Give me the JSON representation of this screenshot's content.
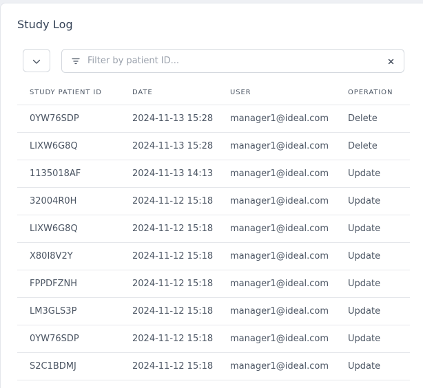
{
  "panel": {
    "title": "Study Log"
  },
  "toolbar": {
    "toggle_icon": "chevron-down-icon",
    "filter_icon": "filter-icon",
    "filter_placeholder": "Filter by patient ID...",
    "filter_value": "",
    "clear_icon": "close-icon"
  },
  "table": {
    "headers": {
      "patient_id": "STUDY PATIENT ID",
      "date": "DATE",
      "user": "USER",
      "operation": "OPERATION"
    },
    "rows": [
      {
        "patient_id": "0YW76SDP",
        "date": "2024-11-13 15:28",
        "user": "manager1@ideal.com",
        "operation": "Delete"
      },
      {
        "patient_id": "LIXW6G8Q",
        "date": "2024-11-13 15:28",
        "user": "manager1@ideal.com",
        "operation": "Delete"
      },
      {
        "patient_id": "1135018AF",
        "date": "2024-11-13 14:13",
        "user": "manager1@ideal.com",
        "operation": "Update"
      },
      {
        "patient_id": "32004R0H",
        "date": "2024-11-12 15:18",
        "user": "manager1@ideal.com",
        "operation": "Update"
      },
      {
        "patient_id": "LIXW6G8Q",
        "date": "2024-11-12 15:18",
        "user": "manager1@ideal.com",
        "operation": "Update"
      },
      {
        "patient_id": "X80I8V2Y",
        "date": "2024-11-12 15:18",
        "user": "manager1@ideal.com",
        "operation": "Update"
      },
      {
        "patient_id": "FPPDFZNH",
        "date": "2024-11-12 15:18",
        "user": "manager1@ideal.com",
        "operation": "Update"
      },
      {
        "patient_id": "LM3GLS3P",
        "date": "2024-11-12 15:18",
        "user": "manager1@ideal.com",
        "operation": "Update"
      },
      {
        "patient_id": "0YW76SDP",
        "date": "2024-11-12 15:18",
        "user": "manager1@ideal.com",
        "operation": "Update"
      },
      {
        "patient_id": "S2C1BDMJ",
        "date": "2024-11-12 15:18",
        "user": "manager1@ideal.com",
        "operation": "Update"
      }
    ]
  }
}
